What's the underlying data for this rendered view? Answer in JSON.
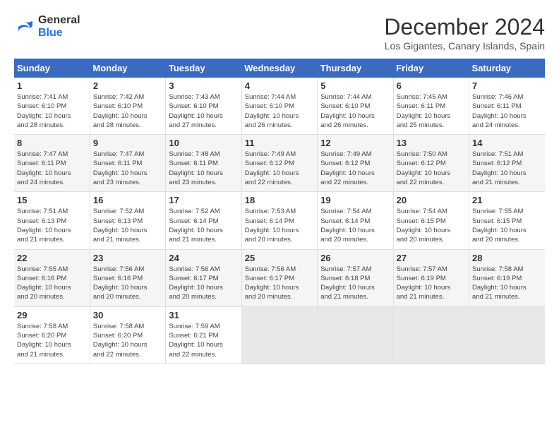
{
  "header": {
    "logo_line1": "General",
    "logo_line2": "Blue",
    "month_title": "December 2024",
    "location": "Los Gigantes, Canary Islands, Spain"
  },
  "columns": [
    "Sunday",
    "Monday",
    "Tuesday",
    "Wednesday",
    "Thursday",
    "Friday",
    "Saturday"
  ],
  "weeks": [
    {
      "days": [
        {
          "num": "1",
          "info": "Sunrise: 7:41 AM\nSunset: 6:10 PM\nDaylight: 10 hours\nand 28 minutes."
        },
        {
          "num": "2",
          "info": "Sunrise: 7:42 AM\nSunset: 6:10 PM\nDaylight: 10 hours\nand 28 minutes."
        },
        {
          "num": "3",
          "info": "Sunrise: 7:43 AM\nSunset: 6:10 PM\nDaylight: 10 hours\nand 27 minutes."
        },
        {
          "num": "4",
          "info": "Sunrise: 7:44 AM\nSunset: 6:10 PM\nDaylight: 10 hours\nand 26 minutes."
        },
        {
          "num": "5",
          "info": "Sunrise: 7:44 AM\nSunset: 6:10 PM\nDaylight: 10 hours\nand 26 minutes."
        },
        {
          "num": "6",
          "info": "Sunrise: 7:45 AM\nSunset: 6:11 PM\nDaylight: 10 hours\nand 25 minutes."
        },
        {
          "num": "7",
          "info": "Sunrise: 7:46 AM\nSunset: 6:11 PM\nDaylight: 10 hours\nand 24 minutes."
        }
      ]
    },
    {
      "days": [
        {
          "num": "8",
          "info": "Sunrise: 7:47 AM\nSunset: 6:11 PM\nDaylight: 10 hours\nand 24 minutes."
        },
        {
          "num": "9",
          "info": "Sunrise: 7:47 AM\nSunset: 6:11 PM\nDaylight: 10 hours\nand 23 minutes."
        },
        {
          "num": "10",
          "info": "Sunrise: 7:48 AM\nSunset: 6:11 PM\nDaylight: 10 hours\nand 23 minutes."
        },
        {
          "num": "11",
          "info": "Sunrise: 7:49 AM\nSunset: 6:12 PM\nDaylight: 10 hours\nand 22 minutes."
        },
        {
          "num": "12",
          "info": "Sunrise: 7:49 AM\nSunset: 6:12 PM\nDaylight: 10 hours\nand 22 minutes."
        },
        {
          "num": "13",
          "info": "Sunrise: 7:50 AM\nSunset: 6:12 PM\nDaylight: 10 hours\nand 22 minutes."
        },
        {
          "num": "14",
          "info": "Sunrise: 7:51 AM\nSunset: 6:12 PM\nDaylight: 10 hours\nand 21 minutes."
        }
      ]
    },
    {
      "days": [
        {
          "num": "15",
          "info": "Sunrise: 7:51 AM\nSunset: 6:13 PM\nDaylight: 10 hours\nand 21 minutes."
        },
        {
          "num": "16",
          "info": "Sunrise: 7:52 AM\nSunset: 6:13 PM\nDaylight: 10 hours\nand 21 minutes."
        },
        {
          "num": "17",
          "info": "Sunrise: 7:52 AM\nSunset: 6:14 PM\nDaylight: 10 hours\nand 21 minutes."
        },
        {
          "num": "18",
          "info": "Sunrise: 7:53 AM\nSunset: 6:14 PM\nDaylight: 10 hours\nand 20 minutes."
        },
        {
          "num": "19",
          "info": "Sunrise: 7:54 AM\nSunset: 6:14 PM\nDaylight: 10 hours\nand 20 minutes."
        },
        {
          "num": "20",
          "info": "Sunrise: 7:54 AM\nSunset: 6:15 PM\nDaylight: 10 hours\nand 20 minutes."
        },
        {
          "num": "21",
          "info": "Sunrise: 7:55 AM\nSunset: 6:15 PM\nDaylight: 10 hours\nand 20 minutes."
        }
      ]
    },
    {
      "days": [
        {
          "num": "22",
          "info": "Sunrise: 7:55 AM\nSunset: 6:16 PM\nDaylight: 10 hours\nand 20 minutes."
        },
        {
          "num": "23",
          "info": "Sunrise: 7:56 AM\nSunset: 6:16 PM\nDaylight: 10 hours\nand 20 minutes."
        },
        {
          "num": "24",
          "info": "Sunrise: 7:56 AM\nSunset: 6:17 PM\nDaylight: 10 hours\nand 20 minutes."
        },
        {
          "num": "25",
          "info": "Sunrise: 7:56 AM\nSunset: 6:17 PM\nDaylight: 10 hours\nand 20 minutes."
        },
        {
          "num": "26",
          "info": "Sunrise: 7:57 AM\nSunset: 6:18 PM\nDaylight: 10 hours\nand 21 minutes."
        },
        {
          "num": "27",
          "info": "Sunrise: 7:57 AM\nSunset: 6:19 PM\nDaylight: 10 hours\nand 21 minutes."
        },
        {
          "num": "28",
          "info": "Sunrise: 7:58 AM\nSunset: 6:19 PM\nDaylight: 10 hours\nand 21 minutes."
        }
      ]
    },
    {
      "days": [
        {
          "num": "29",
          "info": "Sunrise: 7:58 AM\nSunset: 6:20 PM\nDaylight: 10 hours\nand 21 minutes."
        },
        {
          "num": "30",
          "info": "Sunrise: 7:58 AM\nSunset: 6:20 PM\nDaylight: 10 hours\nand 22 minutes."
        },
        {
          "num": "31",
          "info": "Sunrise: 7:59 AM\nSunset: 6:21 PM\nDaylight: 10 hours\nand 22 minutes."
        },
        {
          "num": "",
          "info": ""
        },
        {
          "num": "",
          "info": ""
        },
        {
          "num": "",
          "info": ""
        },
        {
          "num": "",
          "info": ""
        }
      ]
    }
  ]
}
